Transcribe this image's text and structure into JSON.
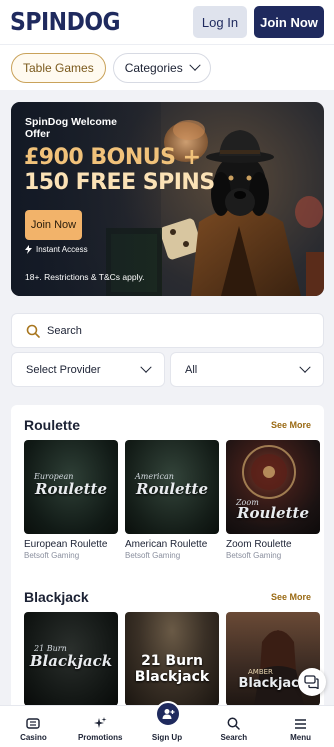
{
  "header": {
    "logo": "SPINDOG",
    "login_label": "Log In",
    "join_label": "Join Now"
  },
  "filters": {
    "active_chip": "Table Games",
    "categories_chip": "Categories"
  },
  "banner": {
    "sub_title": "SpinDog Welcome Offer",
    "line1": "£900 BONUS +",
    "line2": "150 FREE SPINS",
    "cta": "Join Now",
    "instant": "Instant Access",
    "terms": "18+. Restrictions & T&Cs apply."
  },
  "search": {
    "placeholder": "Search"
  },
  "provider_select": {
    "value": "Select Provider"
  },
  "type_select": {
    "value": "All"
  },
  "sections": [
    {
      "title": "Roulette",
      "see_more": "See More",
      "games": [
        {
          "title": "European Roulette",
          "provider": "Betsoft Gaming",
          "thumb_pre": "European",
          "thumb_name": "Roulette"
        },
        {
          "title": "American Roulette",
          "provider": "Betsoft Gaming",
          "thumb_pre": "American",
          "thumb_name": "Roulette"
        },
        {
          "title": "Zoom Roulette",
          "provider": "Betsoft Gaming",
          "thumb_pre": "Zoom",
          "thumb_name": "Roulette"
        }
      ]
    },
    {
      "title": "Blackjack",
      "see_more": "See More",
      "games": [
        {
          "thumb_pre": "21 Burn",
          "thumb_name": "Blackjack"
        },
        {
          "thumb_pre": "21 Burn",
          "thumb_name": "Blackjack"
        },
        {
          "thumb_pre": "AMBER",
          "thumb_name": "Blackjack"
        }
      ]
    }
  ],
  "nav": {
    "casino": "Casino",
    "promotions": "Promotions",
    "signup": "Sign Up",
    "search": "Search",
    "menu": "Menu"
  },
  "colors": {
    "brand": "#1f2a5e",
    "accent": "#f2b36a",
    "see_more": "#9a6a14"
  }
}
